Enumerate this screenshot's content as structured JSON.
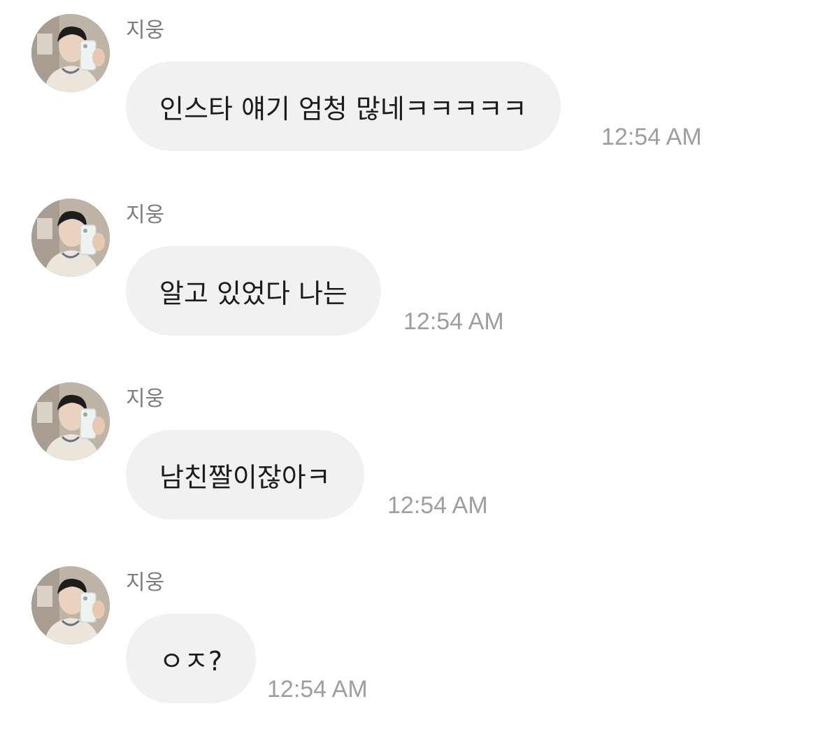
{
  "conversation": {
    "messages": [
      {
        "sender": "지웅",
        "text": "인스타 얘기 엄청 많네ㅋㅋㅋㅋㅋ",
        "time": "12:54 AM"
      },
      {
        "sender": "지웅",
        "text": "알고 있었다 나는",
        "time": "12:54 AM"
      },
      {
        "sender": "지웅",
        "text": "남친짤이잖아ㅋ",
        "time": "12:54 AM"
      },
      {
        "sender": "지웅",
        "text": "ㅇㅈ?",
        "time": "12:54 AM"
      }
    ]
  },
  "avatar_icon": "profile-photo-avatar",
  "colors": {
    "bubble": "#f1f1f4",
    "message_text": "#1c1c1e",
    "sender_name": "#7b7b80",
    "timestamp": "#9d9da2",
    "background": "#ffffff"
  }
}
